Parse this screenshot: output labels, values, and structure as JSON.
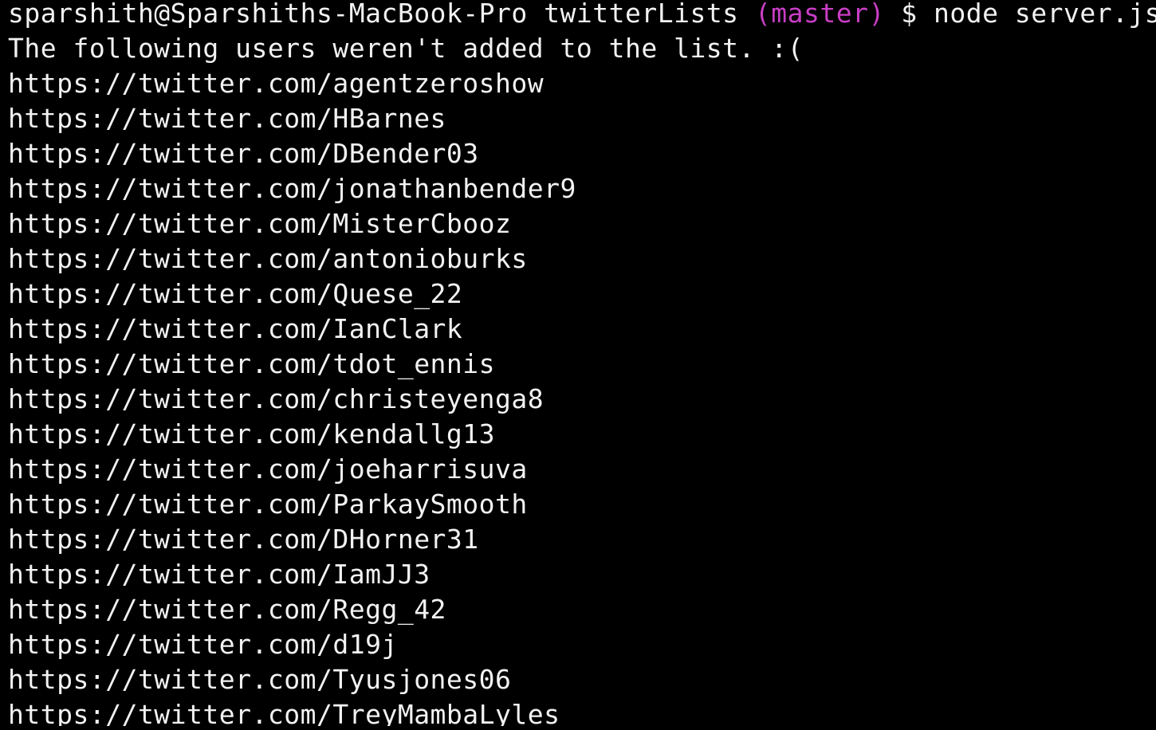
{
  "prompt": {
    "user_host": "sparshith@Sparshiths-MacBook-Pro",
    "cwd": "twitterLists",
    "branch": "(master)",
    "symbol": "$",
    "command": "node server.js"
  },
  "output": {
    "message": "The following users weren't added to the list. :(",
    "urls": [
      "https://twitter.com/agentzeroshow",
      "https://twitter.com/HBarnes",
      "https://twitter.com/DBender03",
      "https://twitter.com/jonathanbender9",
      "https://twitter.com/MisterCbooz",
      "https://twitter.com/antonioburks",
      "https://twitter.com/Quese_22",
      "https://twitter.com/IanClark",
      "https://twitter.com/tdot_ennis",
      "https://twitter.com/christeyenga8",
      "https://twitter.com/kendallg13",
      "https://twitter.com/joeharrisuva",
      "https://twitter.com/ParkaySmooth",
      "https://twitter.com/DHorner31",
      "https://twitter.com/IamJJ3",
      "https://twitter.com/Regg_42",
      "https://twitter.com/d19j",
      "https://twitter.com/Tyusjones06",
      "https://twitter.com/TreyMambaLyles"
    ]
  },
  "colors": {
    "background": "#000000",
    "text": "#f2f2f2",
    "branch": "#c83ec5"
  }
}
